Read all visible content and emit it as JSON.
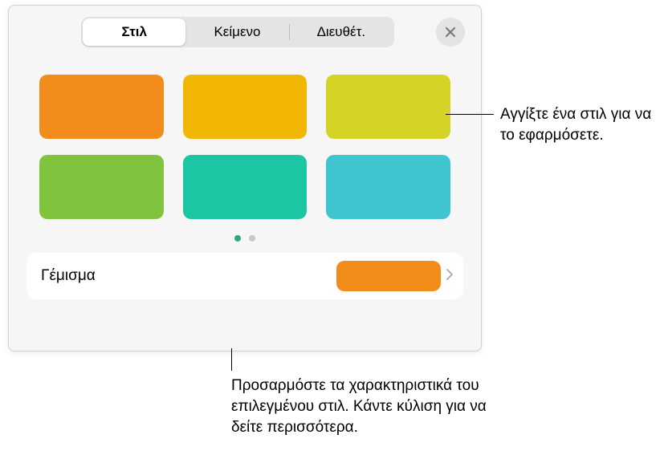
{
  "tabs": {
    "style": "Στιλ",
    "text": "Κείμενο",
    "arrange": "Διευθέτ."
  },
  "swatches": [
    {
      "color": "#f28c1a"
    },
    {
      "color": "#f2b705"
    },
    {
      "color": "#d6d327"
    },
    {
      "color": "#7fc43c"
    },
    {
      "color": "#1bc6a3"
    },
    {
      "color": "#3fc4d0"
    }
  ],
  "fill": {
    "label": "Γέμισμα",
    "color": "#f28c1a"
  },
  "callouts": {
    "apply_style": "Αγγίξτε ένα στιλ για να το εφαρμόσετε.",
    "customize": "Προσαρμόστε τα χαρακτηριστικά του επιλεγμένου στιλ. Κάντε κύλιση για να δείτε περισσότερα."
  }
}
